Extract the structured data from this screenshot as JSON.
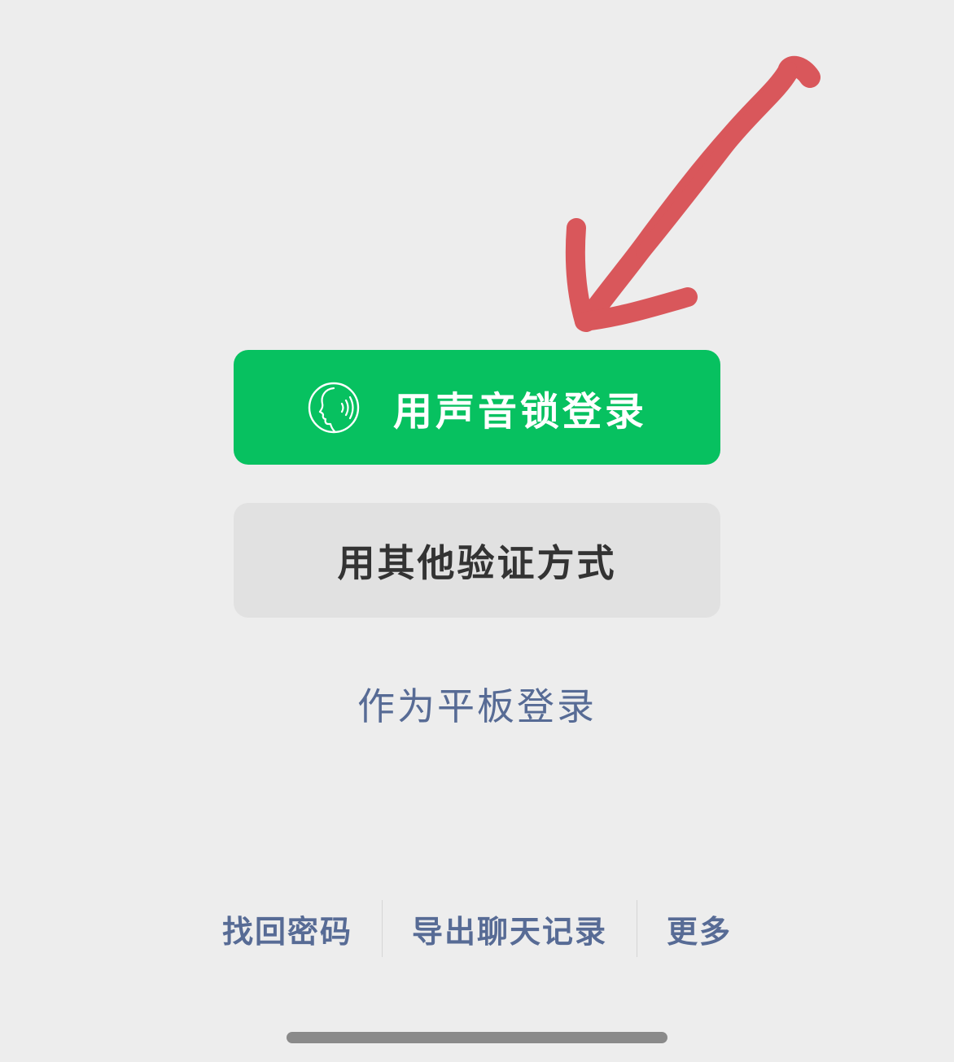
{
  "login": {
    "voice_lock_label": "用声音锁登录",
    "voice_lock_icon": "voice-face-icon",
    "other_method_label": "用其他验证方式",
    "tablet_login_label": "作为平板登录"
  },
  "footer": {
    "links": [
      {
        "label": "找回密码"
      },
      {
        "label": "导出聊天记录"
      },
      {
        "label": "更多"
      }
    ]
  },
  "colors": {
    "primary": "#07c160",
    "link": "#576b95",
    "background": "#ededed",
    "secondary_button": "#e1e1e1",
    "annotation": "#d9575b"
  }
}
